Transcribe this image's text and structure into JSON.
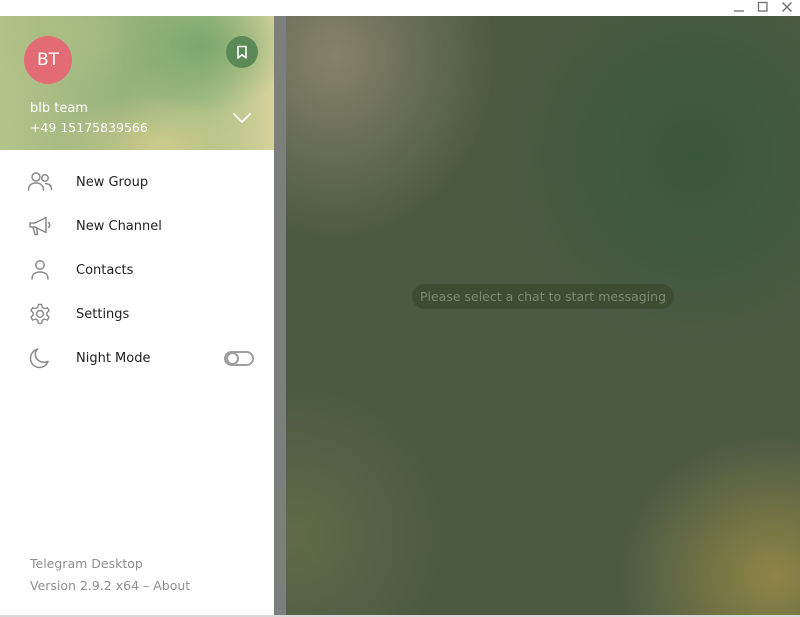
{
  "window": {
    "controls": [
      "minimize-icon",
      "maximize-icon",
      "close-icon"
    ]
  },
  "account": {
    "avatar_initials": "BT",
    "avatar_color": "#e26b74",
    "name": "blb team",
    "phone": "+49 15175839566",
    "saved_icon": "bookmark-icon",
    "expand_icon": "chevron-down-icon"
  },
  "menu": {
    "items": [
      {
        "label": "New Group",
        "icon": "new-group-icon"
      },
      {
        "label": "New Channel",
        "icon": "megaphone-icon"
      },
      {
        "label": "Contacts",
        "icon": "person-icon"
      },
      {
        "label": "Settings",
        "icon": "gear-icon"
      },
      {
        "label": "Night Mode",
        "icon": "moon-icon",
        "toggle": false
      }
    ]
  },
  "chat": {
    "empty_message": "Please select a chat to start messaging"
  },
  "footer": {
    "app_name": "Telegram Desktop",
    "version_prefix": "Version 2.9.2 x64 – ",
    "about_link": "About"
  },
  "colors": {
    "accent": "#5b8a56",
    "drawer_background": "#ffffff",
    "chat_background": "#4c5a44"
  }
}
